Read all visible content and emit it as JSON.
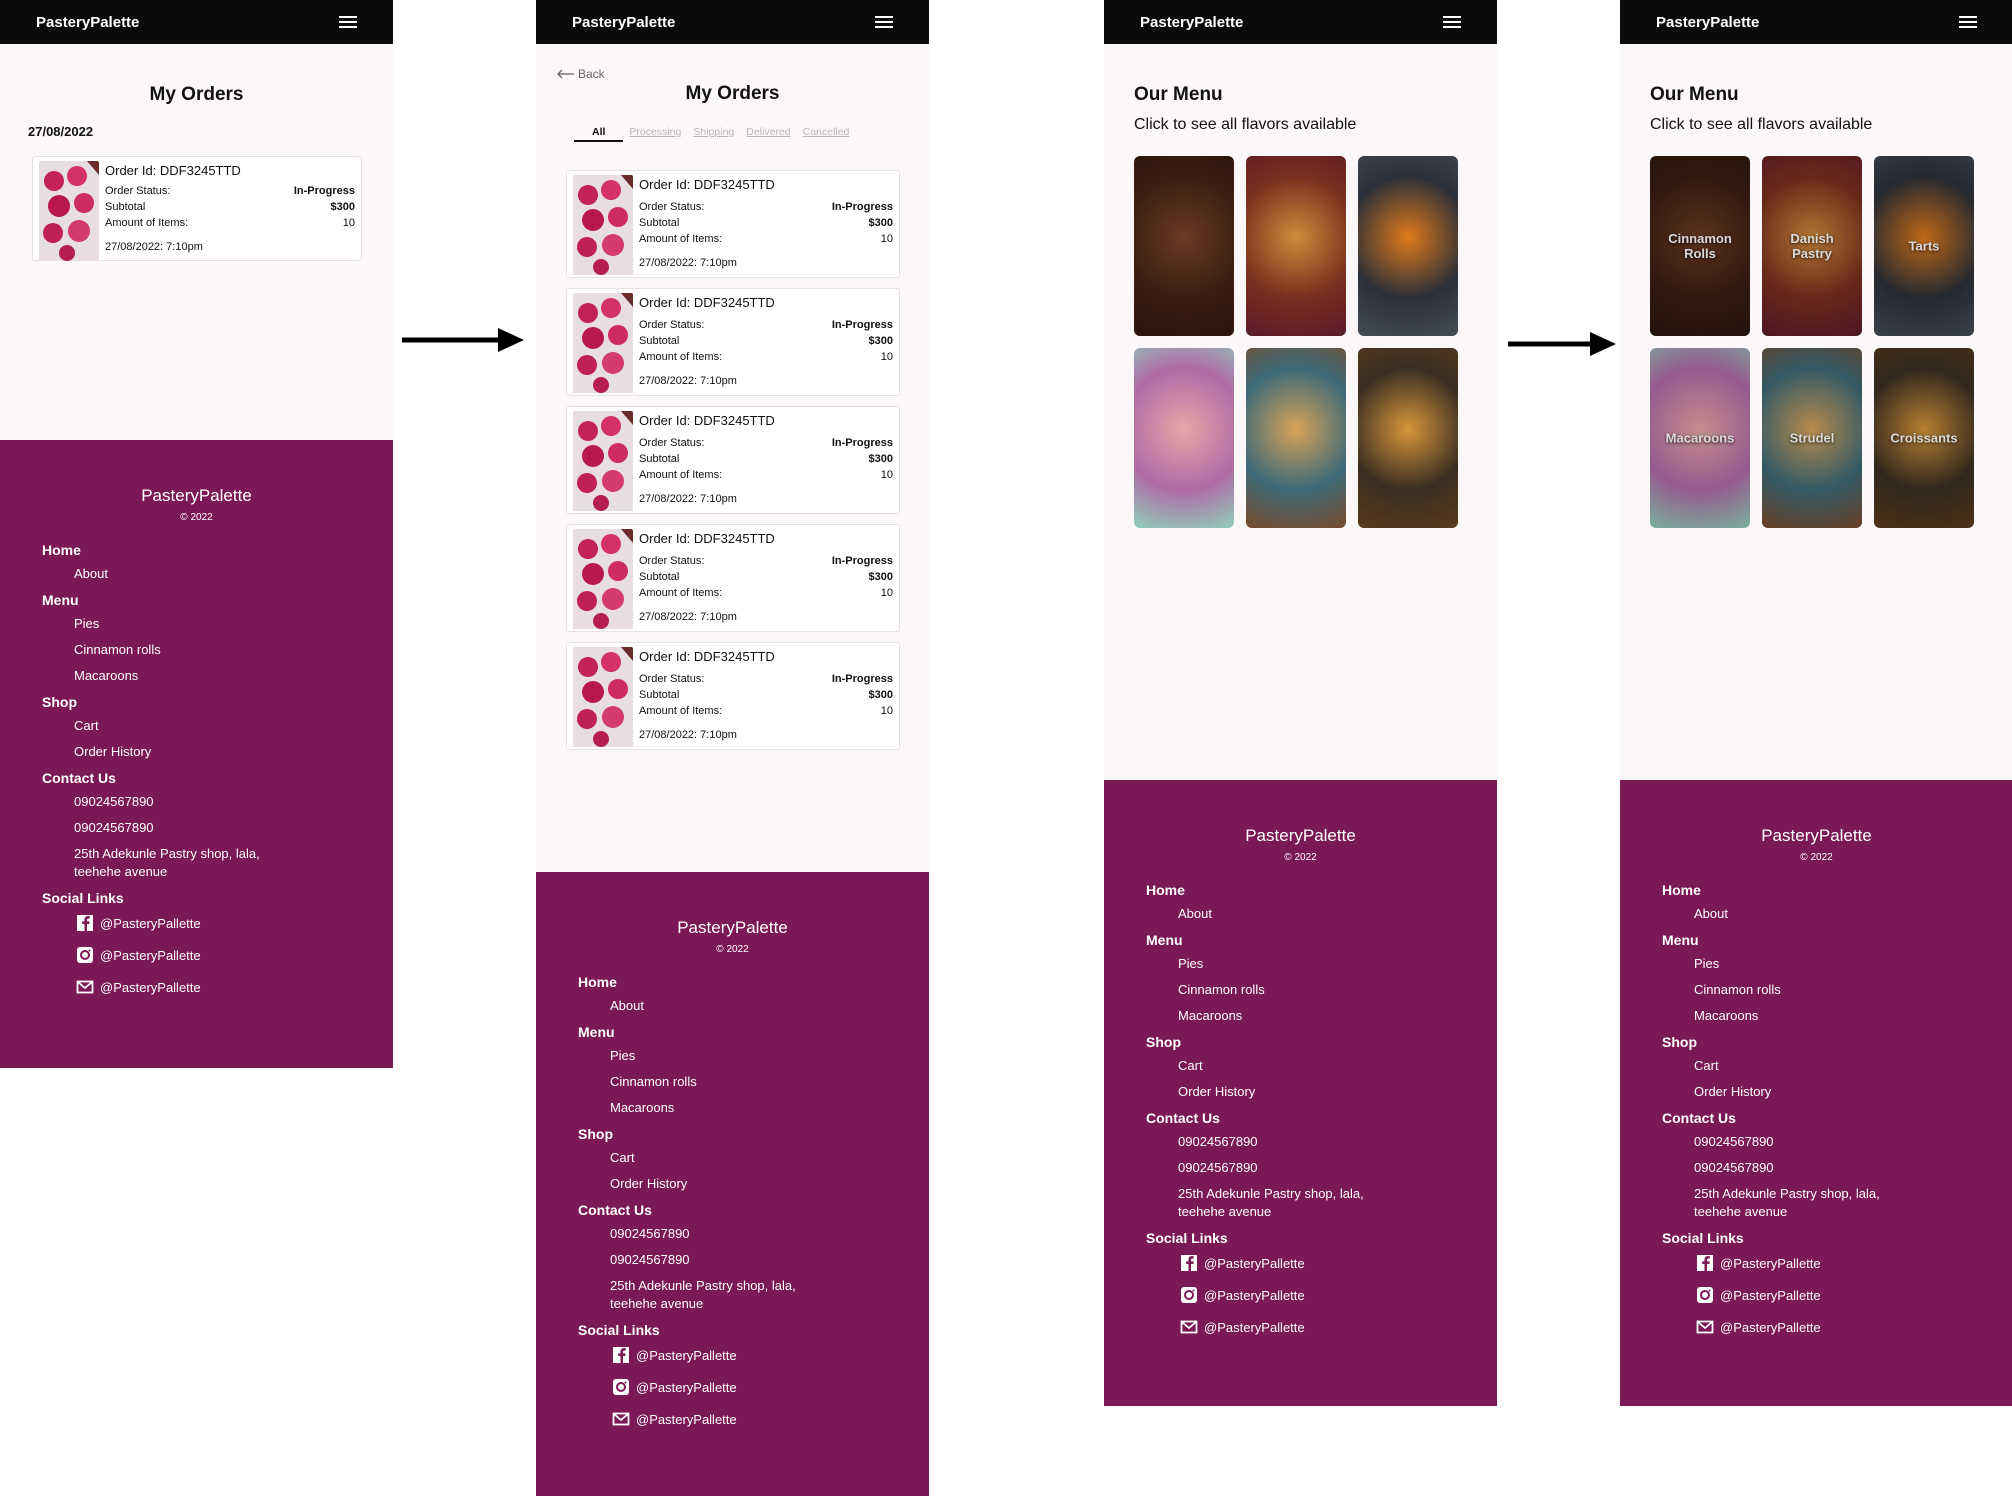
{
  "brand": "PasteryPalette",
  "orders_page": {
    "title": "My Orders",
    "date_heading": "27/08/2022",
    "back_label": "Back",
    "tabs": [
      "All",
      "Processing",
      "Shipping",
      "Delivered",
      "Cancelled"
    ],
    "order": {
      "id": "Order Id: DDF3245TTD",
      "status_label": "Order Status:",
      "status_value": "In-Progress",
      "subtotal_label": "Subtotal",
      "subtotal_value": "$300",
      "items_label": "Amount of Items:",
      "items_value": "10",
      "timestamp": "27/08/2022: 7:10pm"
    }
  },
  "menu_page": {
    "title": "Our Menu",
    "subtitle": "Click to see all flavors available",
    "tiles": [
      "Cinnamon Rolls",
      "Danish Pastry",
      "Tarts",
      "Macaroons",
      "Strudel",
      "Croissants"
    ]
  },
  "footer": {
    "brand": "PasteryPalette",
    "copyright": "© 2022",
    "home": "Home",
    "about": "About",
    "menu": "Menu",
    "pies": "Pies",
    "cinnamon": "Cinnamon rolls",
    "macaroons": "Macaroons",
    "shop": "Shop",
    "cart": "Cart",
    "history": "Order History",
    "contact": "Contact Us",
    "phone1": "09024567890",
    "phone2": "09024567890",
    "address1": "25th Adekunle Pastry shop, lala,",
    "address2": "teehehe avenue",
    "social": "Social Links",
    "handle_fb": "@PasteryPallette",
    "handle_ig": "@PasteryPallette",
    "handle_mail": "@PasteryPallette"
  },
  "colors": {
    "footer": "#7b1856",
    "topbar": "#0b0b0b",
    "page": "#fcf8f9"
  },
  "icons": [
    "menu-icon",
    "back-arrow-icon",
    "facebook-icon",
    "instagram-icon",
    "mail-icon",
    "right-arrow-icon"
  ]
}
